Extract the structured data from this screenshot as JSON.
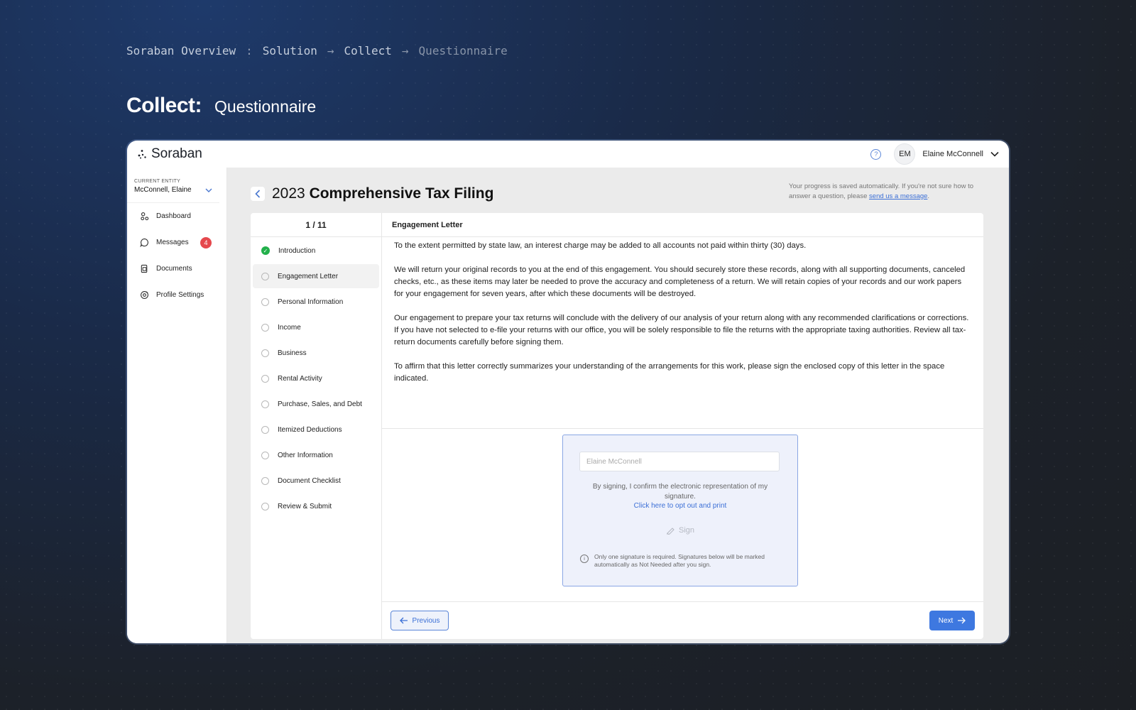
{
  "breadcrumb": {
    "items": [
      "Soraban Overview",
      "Solution",
      "Collect",
      "Questionnaire"
    ],
    "separators": [
      ":",
      "→",
      "→"
    ]
  },
  "heading": {
    "title": "Collect:",
    "subtitle": "Questionnaire"
  },
  "app": {
    "logo": "Soraban",
    "user": {
      "initials": "EM",
      "name": "Elaine McConnell"
    },
    "sidebar": {
      "entity_label": "CURRENT ENTITY",
      "entity_value": "McConnell, Elaine",
      "items": [
        {
          "label": "Dashboard",
          "icon": "dashboard-icon"
        },
        {
          "label": "Messages",
          "icon": "message-icon",
          "badge": "4"
        },
        {
          "label": "Documents",
          "icon": "document-icon"
        },
        {
          "label": "Profile Settings",
          "icon": "settings-icon"
        }
      ]
    },
    "page": {
      "title_year": "2023",
      "title_main": "Comprehensive Tax Filing",
      "save_note": "Your progress is saved automatically. If you're not sure how to answer a question, please",
      "save_link": "send us a message",
      "save_end": "."
    },
    "steps": {
      "counter": "1 / 11",
      "items": [
        {
          "label": "Introduction",
          "status": "complete"
        },
        {
          "label": "Engagement Letter",
          "status": "active"
        },
        {
          "label": "Personal Information",
          "status": "pending"
        },
        {
          "label": "Income",
          "status": "pending"
        },
        {
          "label": "Business",
          "status": "pending"
        },
        {
          "label": "Rental Activity",
          "status": "pending"
        },
        {
          "label": "Purchase, Sales, and Debt",
          "status": "pending"
        },
        {
          "label": "Itemized Deductions",
          "status": "pending"
        },
        {
          "label": "Other Information",
          "status": "pending"
        },
        {
          "label": "Document Checklist",
          "status": "pending"
        },
        {
          "label": "Review & Submit",
          "status": "pending"
        }
      ]
    },
    "section": {
      "title": "Engagement Letter",
      "paragraphs": [
        "To the extent permitted by state law, an interest charge may be added to all accounts not paid within thirty (30) days.",
        "We will return your original records to you at the end of this engagement. You should securely store these records, along with all supporting documents, canceled checks, etc., as these items may later be needed to prove the accuracy and completeness of a return. We will retain copies of your records and our work papers for your engagement for seven years, after which these documents will be destroyed.",
        "Our engagement to prepare your tax returns will conclude with the delivery of our analysis of your return along with any recommended clarifications or corrections. If you have not selected to e-file your returns with our office, you will be solely responsible to file the returns with the appropriate taxing authorities. Review all tax-return documents carefully before signing them.",
        "To affirm that this letter correctly summarizes your understanding of the arrangements for this work, please sign the enclosed copy of this letter in the space indicated."
      ]
    },
    "signature": {
      "placeholder": "Elaine McConnell",
      "confirm_text": "By signing, I confirm the electronic representation of my signature.",
      "opt_out": "Click here to opt out and print",
      "sign_label": "Sign",
      "note": "Only one signature is required. Signatures below will be marked automatically as Not Needed after you sign."
    },
    "footer": {
      "prev_label": "Previous",
      "next_label": "Next"
    }
  },
  "colors": {
    "accent": "#3e78e0",
    "complete": "#22b04b",
    "badge": "#e5484d"
  }
}
